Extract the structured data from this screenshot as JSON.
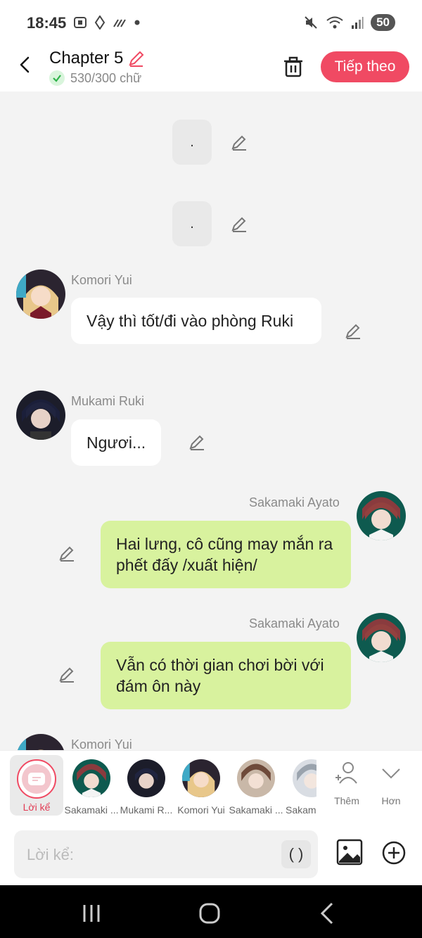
{
  "status": {
    "time": "18:45",
    "battery": "50"
  },
  "header": {
    "title": "Chapter 5",
    "word_count": "530/300 chữ",
    "next_label": "Tiếp theo"
  },
  "messages": {
    "narration1": ".",
    "narration2": ".",
    "m1": {
      "name": "Komori Yui",
      "text": "Vậy thì tốt/đi vào phòng Ruki"
    },
    "m2": {
      "name": "Mukami Ruki",
      "text": "Ngươi..."
    },
    "m3": {
      "name": "Sakamaki Ayato",
      "text": "Hai lưng, cô cũng may mắn ra phết đấy /xuất hiện/"
    },
    "m4": {
      "name": "Sakamaki Ayato",
      "text": "Vẫn có thời gian chơi bời với đám ôn này"
    },
    "m5": {
      "name": "Komori Yui"
    }
  },
  "characters": {
    "narrator": "Lời kể",
    "c1": "Sakamaki ...",
    "c2": "Mukami R...",
    "c3": "Komori Yui",
    "c4": "Sakamaki ...",
    "c5": "Sakam",
    "more_label": "Thêm",
    "expand_label": "Hơn"
  },
  "input": {
    "placeholder": "Lời kể:",
    "paren": "( )"
  },
  "colors": {
    "accent": "#f04a63",
    "right_bubble": "#d8f29e",
    "left_bubble": "#ffffff"
  }
}
